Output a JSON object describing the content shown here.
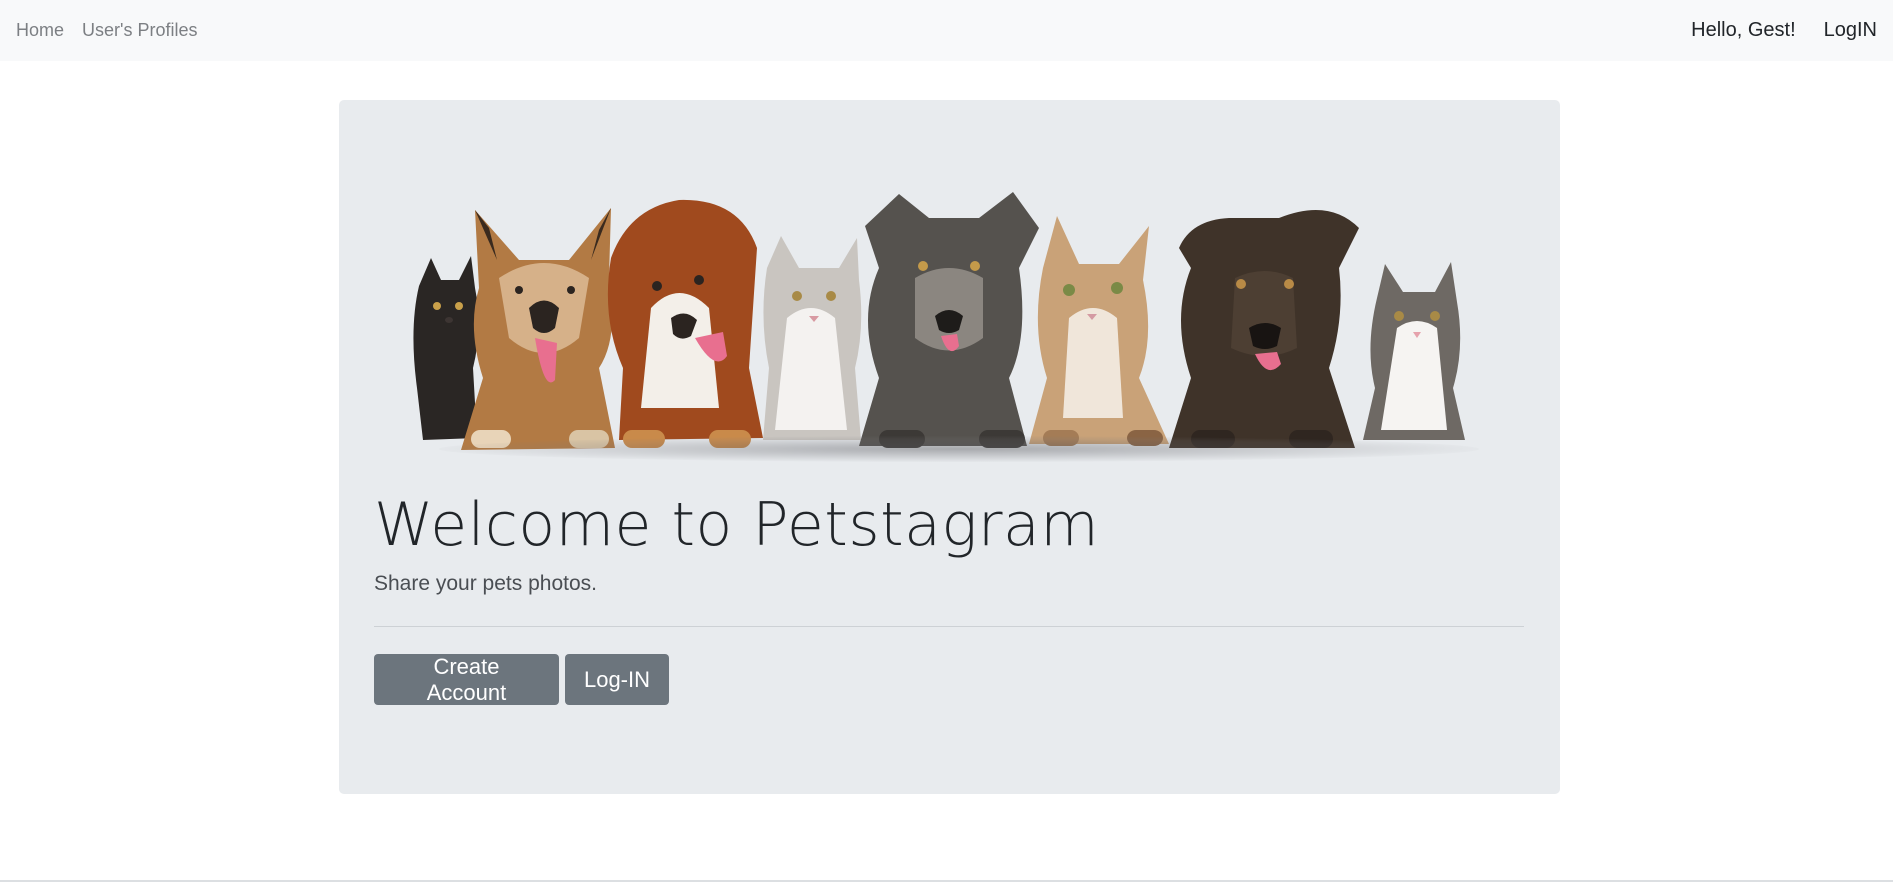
{
  "nav": {
    "home": "Home",
    "profiles": "User's Profiles",
    "greeting": "Hello, Gest!",
    "login": "LogIN"
  },
  "hero": {
    "image_description": "dogs-and-cats-banner",
    "title": "Welcome to Petstagram",
    "subtitle": "Share your pets photos.",
    "create_button": "Create Account",
    "login_button": "Log-IN"
  },
  "colors": {
    "navbar_bg": "#f8f9fa",
    "jumbotron_bg": "#e8ebee",
    "button_bg": "#6c757d",
    "text": "#212529"
  }
}
